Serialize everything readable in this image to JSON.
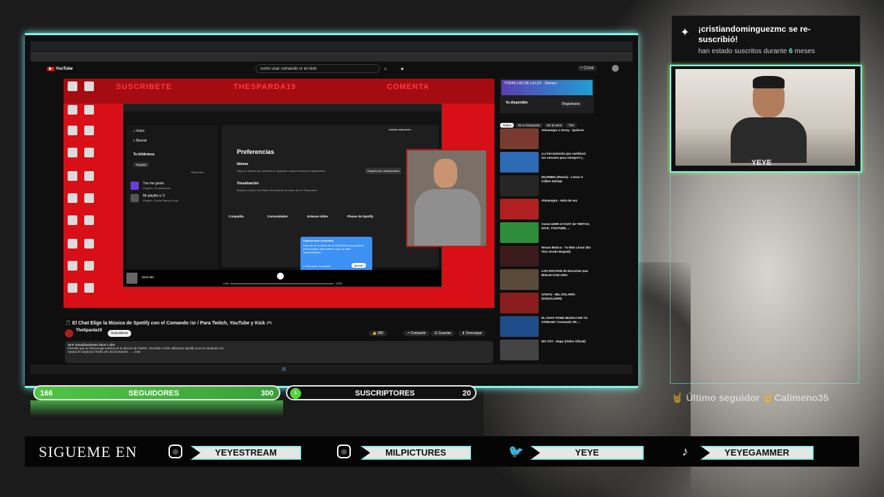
{
  "youtube": {
    "search_query": "como usar comando sr en kick",
    "logo": "YouTube",
    "create_label": "Crear",
    "video_title": "🎵 El Chat Elige la Música de Spotify con el Comando !sr / Para Twitch, YouTube y Kick 🎮",
    "channel_name": "TheSparda19",
    "subscribe_label": "Suscribirse",
    "likes": "280",
    "share_label": "Compartir",
    "save_label": "Guardar",
    "download_label": "Descargar",
    "description_stats": "16 K visualizaciones  hace 1 año",
    "description_line1": "Permite que tu chat ponga música en tu directo de Twitch, YouTube o Kick utilizando Spotify (con el comando !sr).",
    "description_line2": "Apoya al Canal por medio de una Donación ... ...más",
    "chips": [
      "Todos",
      "De tu búsqueda",
      "De la serie",
      "The"
    ],
    "ad_label": "Ya disponible",
    "ad_button": "Regístrarse",
    "player_banner": [
      "SUSCRIBETE",
      "THESPARDA19",
      "COMENTA"
    ],
    "recommendations": [
      {
        "title": "Almanegra x Zorsy - Quieres",
        "color": "#7a3b2e"
      },
      {
        "title": "¡La herramienta que cambiará tus streams para siempre! |...",
        "color": "#2d6bb5"
      },
      {
        "title": "DILEMMA (Remix) · Lenox X Cállan Salvaje",
        "color": "#262626"
      },
      {
        "title": "Almanegra - Hola de vez",
        "color": "#b02020"
      },
      {
        "title": "Como UNIR el CHAT de TWITCH, KICK, YOUTUBE, ...",
        "color": "#2f8c3a"
      },
      {
        "title": "Nexus Bási­co - Tu Mán Llorar (En Vivo Grado Bogotá)",
        "color": "#3a1c1c"
      },
      {
        "title": "LOS DOCSON de Escuchar que BISLIN CON VIDA",
        "color": "#5a4a3a"
      },
      {
        "title": "SANTU - MIL DOLARÍA (VISUALIZER)",
        "color": "#8a1d1d"
      },
      {
        "title": "EL CHAT PONE MUSICA EN TU STREAM / Comando SR ...",
        "color": "#1f4d8a"
      },
      {
        "title": "NO CSY - Rapo (Video Oficial)",
        "color": "#444"
      }
    ]
  },
  "spotify": {
    "home": "Inicio",
    "search": "Buscar",
    "library": "Tu biblioteca",
    "playlists_chip": "Playlists",
    "recent_label": "Recientes",
    "liked": "Tus me gusta",
    "liked_meta": "Playlist • 16 canciones",
    "playlist_1": "Mi playlist n.º1",
    "playlist_1_meta": "Playlist • Dante Ramos Zona",
    "install": "Instalar aplicación",
    "preferences_title": "Preferencias",
    "idioma": "Idioma",
    "idioma_desc": "Elige un idioma (los cambios se aplicarán cuando reinicies la aplicación)",
    "idioma_value": "Español de Latinoamérica",
    "visual": "Visualización",
    "visual_desc": "Mostrar el panel de Estás escuchando al hacer clic en Reproducir",
    "footer_cols": [
      "Compañía",
      "Comunidades",
      "Enlaces útiles",
      "Planes de Spotify"
    ],
    "popup_title": "Explora más contenido",
    "popup_body": "Haz clic en el botón de la vista Estás escuchando para mostrar más sobre lo que se está reproduciendo.",
    "popup_dismiss": "No volver a mostrar",
    "popup_button": "Ignorar",
    "now_playing": "Save Me",
    "time_current": "1:24",
    "time_total": "3:23"
  },
  "notification": {
    "title": "¡cristiandominguezmc se re-suscribió!",
    "sub_prefix": "han estado suscritos durante",
    "months": "6",
    "sub_suffix": "meses"
  },
  "facecam_label": "YEYE",
  "last_follower": "🤘 Último seguidor 🤘Calimeno35",
  "goals": {
    "followers_current": "166",
    "followers_label": "SEGUIDORES",
    "followers_target": "300",
    "subs_current": "1",
    "subs_label": "SUSCRIPTORES",
    "subs_target": "20",
    "followers_progress": 0.553
  },
  "footer": {
    "heading": "SIGUEME EN",
    "handles": [
      "YEYESTREAM",
      "MILPICTURES",
      "YEYE",
      "YEYEGAMMER"
    ],
    "icons": [
      "instagram-icon",
      "instagram-icon",
      "twitter-icon",
      "tiktok-icon"
    ]
  },
  "colors": {
    "accent": "#7ff3e9",
    "goal_green": "#51c443",
    "youtube_red": "#ff0000",
    "player_red": "#d80f17"
  }
}
